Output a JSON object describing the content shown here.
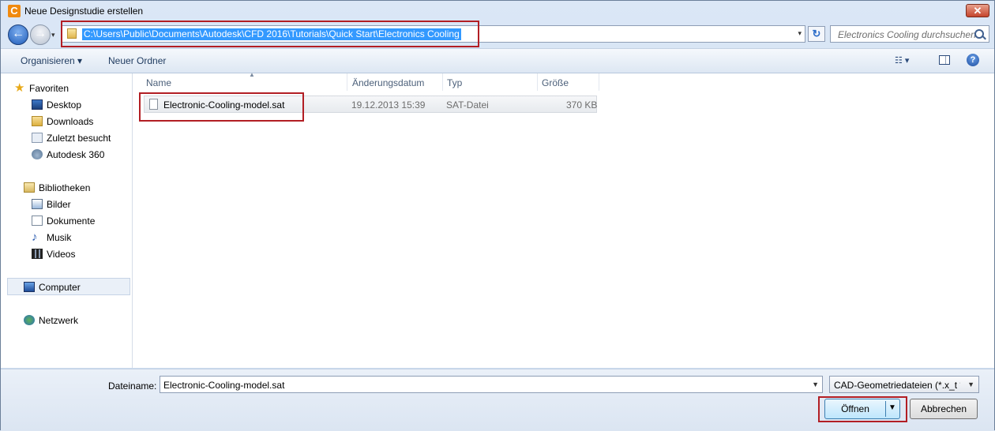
{
  "window": {
    "title": "Neue Designstudie erstellen",
    "app_icon_letter": "C",
    "close_glyph": "✕"
  },
  "nav": {
    "back_glyph": "←",
    "forward_glyph": "→",
    "dropdown_glyph": "▾",
    "address": "C:\\Users\\Public\\Documents\\Autodesk\\CFD 2016\\Tutorials\\Quick Start\\Electronics Cooling",
    "refresh_glyph": "↻",
    "search_placeholder": "Electronics Cooling durchsuchen"
  },
  "toolbar": {
    "organize": "Organisieren ▾",
    "new_folder": "Neuer Ordner",
    "view": "☷ ▾",
    "help": "?"
  },
  "sidebar": {
    "favorites": "Favoriten",
    "desktop": "Desktop",
    "downloads": "Downloads",
    "recent": "Zuletzt besucht",
    "autodesk360": "Autodesk 360",
    "libraries": "Bibliotheken",
    "pictures": "Bilder",
    "documents": "Dokumente",
    "music": "Musik",
    "videos": "Videos",
    "computer": "Computer",
    "network": "Netzwerk",
    "star_glyph": "★",
    "note_glyph": "♪"
  },
  "columns": {
    "name": "Name",
    "modified": "Änderungsdatum",
    "type": "Typ",
    "size": "Größe",
    "sort_glyph": "▲"
  },
  "files": [
    {
      "name": "Electronic-Cooling-model.sat",
      "modified": "19.12.2013 15:39",
      "type": "SAT-Datei",
      "size": "370 KB"
    }
  ],
  "footer": {
    "filename_label": "Dateiname:",
    "filename_value": "Electronic-Cooling-model.sat",
    "filetype": "CAD-Geometriedateien (*.x_t *.",
    "open": "Öffnen",
    "cancel": "Abbrechen",
    "dropdown_glyph": "▼"
  },
  "colors": {
    "highlight_outline": "#b21e24",
    "address_selection": "#3399ff"
  }
}
